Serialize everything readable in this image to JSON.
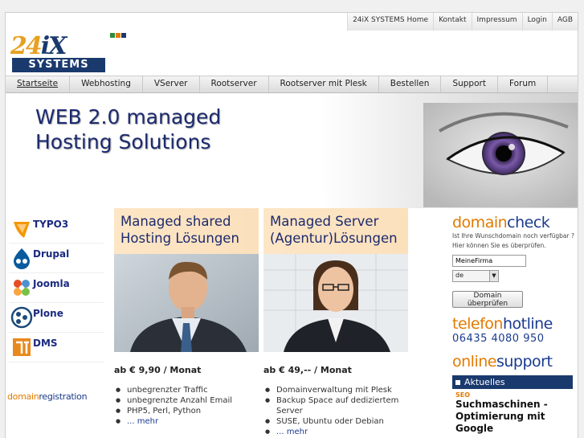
{
  "topnav": [
    "24iX SYSTEMS Home",
    "Kontakt",
    "Impressum",
    "Login",
    "AGB"
  ],
  "logo": {
    "num": "24",
    "ix": "iX",
    "systems": "SYSTEMS"
  },
  "colors": {
    "square1": "#2e8b3a",
    "square2": "#e27a00",
    "square3": "#1a3a6e",
    "navy": "#1a3a6e",
    "orange": "#e27a00"
  },
  "mainmenu": [
    "Startseite",
    "Webhosting",
    "VServer",
    "Rootserver",
    "Rootserver mit Plesk",
    "Bestellen",
    "Support",
    "Forum"
  ],
  "hero": {
    "line1": "WEB 2.0 managed",
    "line2": "Hosting Solutions"
  },
  "cms": [
    {
      "label": "TYPO3",
      "icon": "typo3-icon"
    },
    {
      "label": "Drupal",
      "icon": "drupal-icon"
    },
    {
      "label": "Joomla",
      "icon": "joomla-icon"
    },
    {
      "label": "Plone",
      "icon": "plone-icon"
    },
    {
      "label": "DMS",
      "icon": "dms-icon"
    }
  ],
  "domainregistration": {
    "a": "domain",
    "b": "registration"
  },
  "col1": {
    "banner1": "Managed shared",
    "banner2": "Hosting Lösungen",
    "price": "ab € 9,90 / Monat",
    "items": [
      "unbegrenzter Traffic",
      "unbegrenzte Anzahl Email",
      "PHP5, Perl, Python"
    ],
    "more": "... mehr"
  },
  "col2": {
    "banner1": "Managed Server",
    "banner2": "(Agentur)Lösungen",
    "price": "ab € 49,-- / Monat",
    "items": [
      "Domainverwaltung mit Plesk",
      "Backup Space auf dediziertem Server",
      "SUSE, Ubuntu oder Debian"
    ],
    "more": "... mehr"
  },
  "domaincheck": {
    "a": "domain",
    "b": "check",
    "text1": "Ist Ihre Wunschdomain noch verfügbar ?",
    "text2": "Hier können Sie es überprüfen.",
    "input_value": "MeineFirma",
    "tld": "de",
    "button": "Domain überprüfen"
  },
  "hotline": {
    "a": "telefon",
    "b": "hotline",
    "number": "06435 4080 950"
  },
  "online": {
    "a": "online",
    "b": "support"
  },
  "aktuelles": "Aktuelles",
  "news": {
    "tag": "SEO",
    "title1": "Suchmaschinen -",
    "title2": "Optimierung mit Google"
  }
}
